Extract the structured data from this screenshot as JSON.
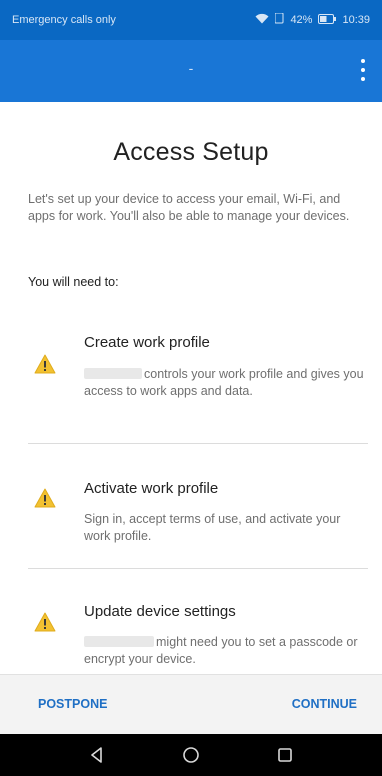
{
  "status_bar": {
    "carrier": "Emergency calls only",
    "battery": "42%",
    "time": "10:39"
  },
  "app_bar": {
    "title": "-",
    "menu_icon": "more-vert-icon"
  },
  "page": {
    "title": "Access Setup",
    "intro": "Let's set up your device to access your email, Wi-Fi, and apps for work. You'll also be able to manage your devices.",
    "need_label": "You will need to:"
  },
  "tasks": [
    {
      "icon": "warning-icon",
      "title": "Create work profile",
      "description": "controls your work profile and gives you access to work apps and data."
    },
    {
      "icon": "warning-icon",
      "title": "Activate work profile",
      "description": "Sign in, accept terms of use, and activate your work profile."
    },
    {
      "icon": "warning-icon",
      "title": "Update device settings",
      "description": "might need you to set a passcode or encrypt your device."
    }
  ],
  "actions": {
    "postpone": "POSTPONE",
    "continue": "CONTINUE"
  },
  "colors": {
    "status_bar": "#0a68c3",
    "app_bar": "#1976d6",
    "accent": "#1f6fc4",
    "warning": "#f2c131"
  },
  "navigation": [
    "back-icon",
    "home-icon",
    "recents-icon"
  ]
}
